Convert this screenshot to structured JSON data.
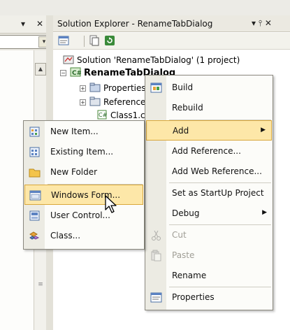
{
  "left_panel": {
    "dropdown_glyph": "▾",
    "close_glyph": "✕",
    "scroll_up_glyph": "▲",
    "scroll_grip_glyph": "≡"
  },
  "solution_explorer": {
    "title": "Solution Explorer - RenameTabDialog",
    "title_controls": "▾  ⫯  ✕",
    "tree": {
      "solution": "Solution 'RenameTabDialog' (1 project)",
      "project": "RenameTabDialog",
      "properties": "Properties",
      "references": "References",
      "class1": "Class1.cs"
    }
  },
  "project_menu": {
    "items": [
      {
        "label": "Build",
        "icon": "build-icon"
      },
      {
        "label": "Rebuild"
      },
      {
        "label": "Add",
        "highlighted": true,
        "submenu_arrow": "▶"
      },
      {
        "label": "Add Reference..."
      },
      {
        "label": "Add Web Reference..."
      },
      {
        "label": "Set as StartUp Project"
      },
      {
        "label": "Debug",
        "submenu_arrow": "▶"
      },
      {
        "label": "Cut",
        "disabled": true,
        "icon": "scissors-icon"
      },
      {
        "label": "Paste",
        "disabled": true,
        "icon": "paste-icon"
      },
      {
        "label": "Rename"
      },
      {
        "label": "Properties",
        "icon": "properties-icon"
      }
    ]
  },
  "add_submenu": {
    "items": [
      {
        "label": "New Item...",
        "icon": "new-item-icon"
      },
      {
        "label": "Existing Item...",
        "icon": "existing-item-icon"
      },
      {
        "label": "New Folder",
        "icon": "folder-icon"
      },
      {
        "label": "Windows Form...",
        "icon": "windows-form-icon",
        "highlighted": true
      },
      {
        "label": "User Control...",
        "icon": "user-control-icon"
      },
      {
        "label": "Class...",
        "icon": "class-icon"
      }
    ]
  },
  "colors": {
    "highlight_fill": "#fde7a8",
    "highlight_border": "#d9a73a",
    "menu_gutter": "#ecebe3",
    "disabled_text": "#a09e96"
  }
}
